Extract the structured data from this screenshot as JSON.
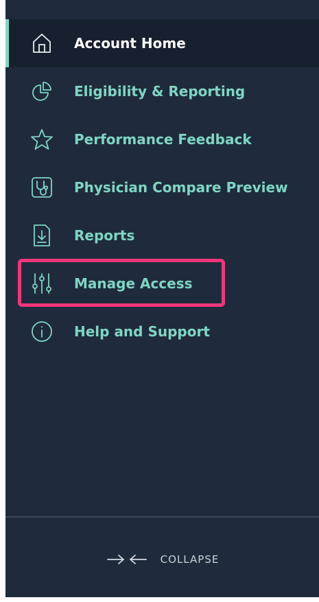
{
  "nav": {
    "items": [
      {
        "label": "Account Home",
        "icon": "home-icon",
        "active": true
      },
      {
        "label": "Eligibility & Reporting",
        "icon": "pie-chart-icon",
        "active": false
      },
      {
        "label": "Performance Feedback",
        "icon": "star-icon",
        "active": false
      },
      {
        "label": "Physician Compare Preview",
        "icon": "stethoscope-icon",
        "active": false
      },
      {
        "label": "Reports",
        "icon": "download-report-icon",
        "active": false
      },
      {
        "label": "Manage Access",
        "icon": "sliders-icon",
        "active": false,
        "highlighted": true
      },
      {
        "label": "Help and Support",
        "icon": "info-icon",
        "active": false
      }
    ]
  },
  "collapse": {
    "label": "COLLAPSE",
    "icon": "collapse-arrows-icon"
  },
  "colors": {
    "sidebar_bg": "#1f2b3c",
    "active_bg": "#16202e",
    "accent": "#7fd6c3",
    "highlight": "#f0367a"
  }
}
